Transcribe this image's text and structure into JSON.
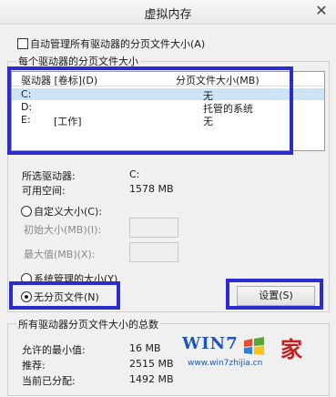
{
  "window": {
    "title": "虚拟内存",
    "close_glyph": "✕"
  },
  "auto_manage": {
    "label": "自动管理所有驱动器的分页文件大小(A)",
    "checked": false
  },
  "per_drive": {
    "legend": "每个驱动器的分页文件大小",
    "columns": [
      "驱动器 [卷标](D)",
      "分页文件大小(MB)"
    ],
    "rows": [
      {
        "drive": "C:",
        "label": "",
        "size": "无",
        "selected": true
      },
      {
        "drive": "D:",
        "label": "",
        "size": "托管的系统",
        "selected": false
      },
      {
        "drive": "E:",
        "label": "[工作]",
        "size": "无",
        "selected": false
      }
    ],
    "selected_drive_label": "所选驱动器:",
    "selected_drive_value": "C:",
    "free_space_label": "可用空间:",
    "free_space_value": "1578 MB",
    "custom_size_label": "自定义大小(C):",
    "initial_size_label": "初始大小(MB)(I):",
    "max_size_label": "最大值(MB)(X):",
    "system_managed_label": "系统管理的大小(Y)",
    "no_paging_label": "无分页文件(N)",
    "selected_option": "no_paging",
    "set_button": "设置(S)"
  },
  "totals": {
    "legend": "所有驱动器分页文件大小的总数",
    "min_label": "允许的最小值:",
    "min_value": "16 MB",
    "recommended_label": "推荐:",
    "recommended_value": "2515 MB",
    "current_label": "当前已分配:",
    "current_value": "1492 MB"
  },
  "watermark": {
    "logo_text": "WIN7",
    "brand_char": "家",
    "url": "www.win7zhijia.cn"
  },
  "colors": {
    "highlight_box": "#2b2bd0",
    "selection": "#cde4f7",
    "watermark_blue": "#1e55b8",
    "watermark_red": "#c21e1e"
  }
}
